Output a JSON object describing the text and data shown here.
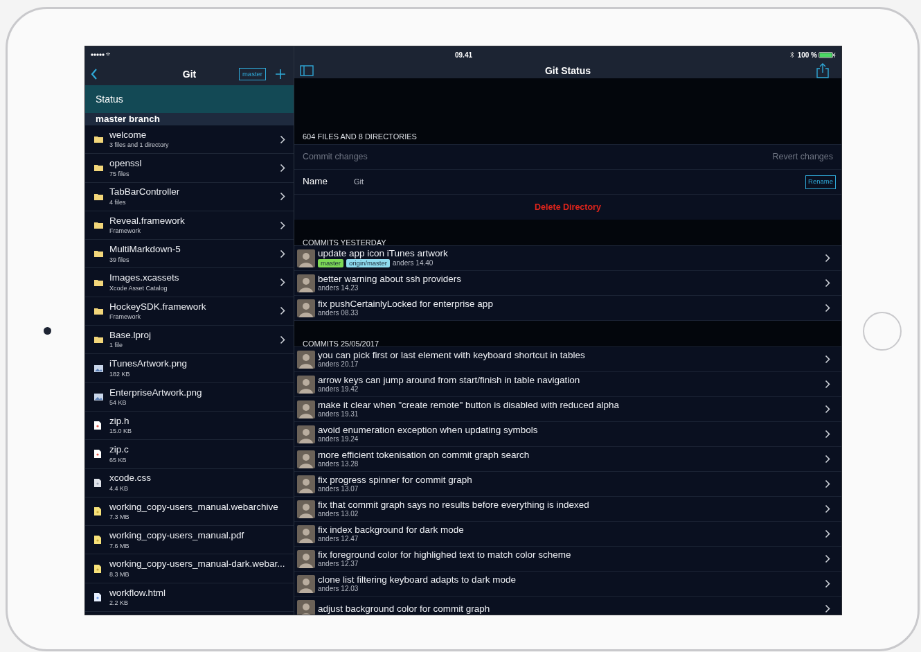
{
  "status_bar": {
    "time": "09.41",
    "battery": "100 %"
  },
  "sidebar": {
    "title": "Git",
    "branch_button": "master",
    "status_item": {
      "label": "Status",
      "selected": true
    },
    "section": "master branch",
    "items": [
      {
        "kind": "folder",
        "name": "welcome",
        "detail": "3 files and 1 directory"
      },
      {
        "kind": "folder",
        "name": "openssl",
        "detail": "75 files"
      },
      {
        "kind": "folder",
        "name": "TabBarController",
        "detail": "4 files"
      },
      {
        "kind": "folder",
        "name": "Reveal.framework",
        "detail": "Framework"
      },
      {
        "kind": "folder",
        "name": "MultiMarkdown-5",
        "detail": "39 files"
      },
      {
        "kind": "folder",
        "name": "Images.xcassets",
        "detail": "Xcode Asset Catalog"
      },
      {
        "kind": "folder",
        "name": "HockeySDK.framework",
        "detail": "Framework"
      },
      {
        "kind": "folder",
        "name": "Base.lproj",
        "detail": "1 file"
      },
      {
        "kind": "image",
        "name": "iTunesArtwork.png",
        "detail": "182 KB"
      },
      {
        "kind": "image",
        "name": "EnterpriseArtwork.png",
        "detail": "54 KB"
      },
      {
        "kind": "source",
        "name": "zip.h",
        "detail": "15.0 KB"
      },
      {
        "kind": "source",
        "name": "zip.c",
        "detail": "65 KB"
      },
      {
        "kind": "text",
        "name": "xcode.css",
        "detail": "4.4 KB"
      },
      {
        "kind": "document",
        "name": "working_copy-users_manual.webarchive",
        "detail": "7.3 MB"
      },
      {
        "kind": "document",
        "name": "working_copy-users_manual.pdf",
        "detail": "7.6 MB"
      },
      {
        "kind": "document",
        "name": "working_copy-users_manual-dark.webar...",
        "detail": "8.3 MB"
      },
      {
        "kind": "web",
        "name": "workflow.html",
        "detail": "2.2 KB"
      }
    ]
  },
  "detail": {
    "title": "Git Status",
    "summary": "604 FILES AND 8 DIRECTORIES",
    "commit_action": "Commit changes",
    "revert_action": "Revert changes",
    "name_label": "Name",
    "name_value": "Git",
    "rename_button": "Rename",
    "delete_button": "Delete Directory",
    "sections": [
      {
        "title": "COMMITS YESTERDAY",
        "commits": [
          {
            "message": "update app icon iTunes artwork",
            "tags": [
              {
                "label": "master",
                "color": "#7ed957"
              },
              {
                "label": "origin/master",
                "color": "#8fdcef"
              }
            ],
            "meta": "anders 14.40"
          },
          {
            "message": "better warning about ssh providers",
            "meta": "anders 14.23"
          },
          {
            "message": "fix pushCertainlyLocked for enterprise app",
            "meta": "anders 08.33"
          }
        ]
      },
      {
        "title": "COMMITS 25/05/2017",
        "commits": [
          {
            "message": "you can pick first or last element with keyboard shortcut in tables",
            "meta": "anders 20.17"
          },
          {
            "message": "arrow keys can jump around from start/finish in table navigation",
            "meta": "anders 19.42"
          },
          {
            "message": "make it clear when \"create remote\" button is disabled with reduced alpha",
            "meta": "anders 19.31"
          },
          {
            "message": "avoid enumeration exception when updating symbols",
            "meta": "anders 19.24"
          },
          {
            "message": "more efficient tokenisation on commit graph search",
            "meta": "anders 13.28"
          },
          {
            "message": "fix progress spinner for commit graph",
            "meta": "anders 13.07"
          },
          {
            "message": "fix that commit graph says no results before everything is indexed",
            "meta": "anders 13.02"
          },
          {
            "message": "fix index background for dark mode",
            "meta": "anders 12.47"
          },
          {
            "message": "fix foreground color for highlighed text to match color scheme",
            "meta": "anders 12.37"
          },
          {
            "message": "clone list filtering keyboard adapts to dark mode",
            "meta": "anders 12.03"
          },
          {
            "message": "adjust background color for commit graph"
          }
        ]
      }
    ]
  }
}
